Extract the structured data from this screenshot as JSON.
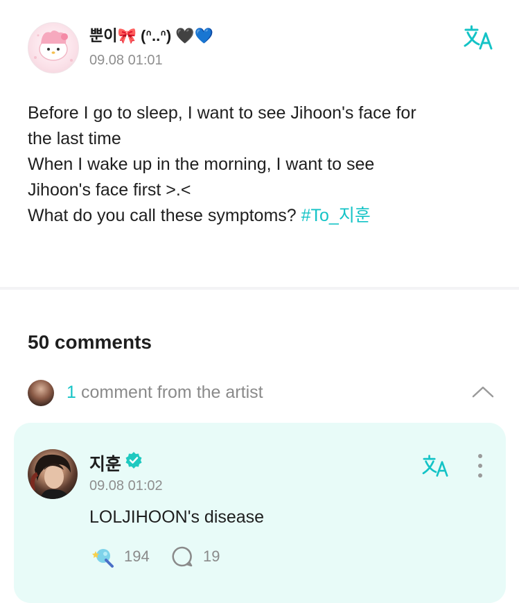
{
  "post": {
    "author_name": "뿐이🎀 (ᐢ..ᐢ) 🖤💙",
    "timestamp": "09.08 01:01",
    "body_lines": [
      "Before I go to sleep, I want to see Jihoon's face for",
      "the last time",
      "When I wake up in the morning, I want to see",
      "Jihoon's face first >.<",
      "What do you call these symptoms? "
    ],
    "hashtag": "#To_지훈",
    "translate_icon": "translate-icon"
  },
  "comments": {
    "title": "50 comments",
    "artist_count": "1",
    "artist_label": "comment from the artist"
  },
  "artist_comment": {
    "name": "지훈",
    "timestamp": "09.08 01:02",
    "text": "LOLJIHOON's disease",
    "reaction_count": "194",
    "reply_count": "19"
  },
  "colors": {
    "accent": "#14c3c6",
    "card_bg": "#e8fbf8",
    "muted": "#8e8e8e",
    "verified": "#1fc9c0"
  }
}
